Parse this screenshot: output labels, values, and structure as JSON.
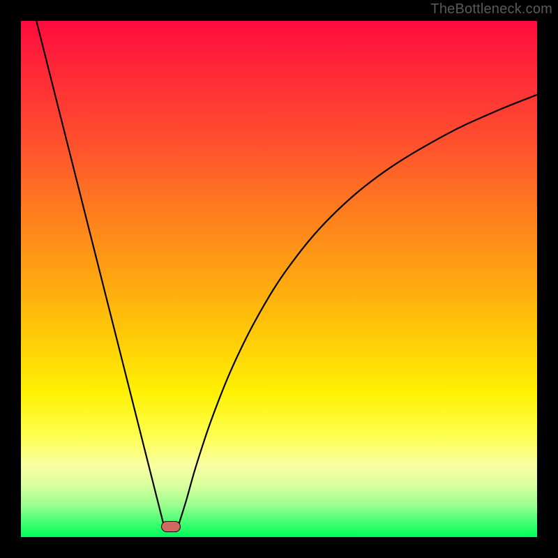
{
  "watermark": "TheBottleneck.com",
  "chart_data": {
    "type": "line",
    "title": "",
    "xlabel": "",
    "ylabel": "",
    "xlim": [
      0,
      100
    ],
    "ylim": [
      0,
      100
    ],
    "grid": false,
    "legend": false,
    "series": [
      {
        "name": "left-branch",
        "x": [
          3.0,
          27.7
        ],
        "values": [
          100.0,
          2.2
        ]
      },
      {
        "name": "right-branch",
        "x": [
          30.5,
          32.0,
          34.0,
          37.0,
          41.0,
          46.0,
          52.0,
          60.0,
          70.0,
          82.0,
          92.0,
          100.0
        ],
        "values": [
          2.2,
          7.0,
          14.0,
          23.0,
          33.0,
          43.0,
          52.5,
          62.0,
          70.5,
          77.8,
          82.5,
          85.7
        ]
      }
    ],
    "marker": {
      "x": 29.0,
      "y": 2.0
    },
    "colors": {
      "line": "#000000",
      "marker_fill": "#cf6a61",
      "gradient_top": "#ff0b3e",
      "gradient_bottom": "#00ff57"
    }
  }
}
